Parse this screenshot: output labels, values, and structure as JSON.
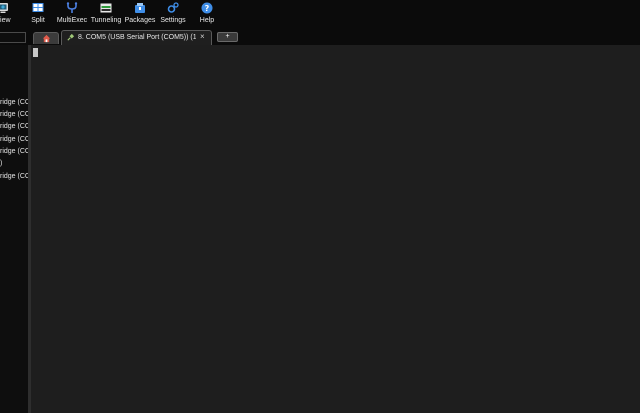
{
  "toolbar": {
    "items": [
      {
        "label": "View",
        "icon": "view-icon"
      },
      {
        "label": "Split",
        "icon": "split-icon"
      },
      {
        "label": "MultiExec",
        "icon": "multiexec-icon"
      },
      {
        "label": "Tunneling",
        "icon": "tunneling-icon"
      },
      {
        "label": "Packages",
        "icon": "packages-icon"
      },
      {
        "label": "Settings",
        "icon": "settings-icon"
      },
      {
        "label": "Help",
        "icon": "help-icon"
      }
    ]
  },
  "tabs": {
    "home_icon": "home-icon",
    "session": {
      "title": "8. COM5  (USB Serial Port (COM5)) (1",
      "close": "×",
      "icon": "plug-icon"
    },
    "new_tab": "+"
  },
  "sidebar": {
    "items": [
      {
        "label": "ridge (CC"
      },
      {
        "label": "ridge (CC"
      },
      {
        "label": "ridge (CC"
      },
      {
        "label": "ridge (CC"
      },
      {
        "label": "ridge (CC"
      },
      {
        "label": ")"
      },
      {
        "label": "ridge (CC"
      }
    ]
  },
  "colors": {
    "accent_blue": "#3f8ee8",
    "terminal_bg": "#1e1e1e",
    "home_red": "#e05a4a"
  }
}
